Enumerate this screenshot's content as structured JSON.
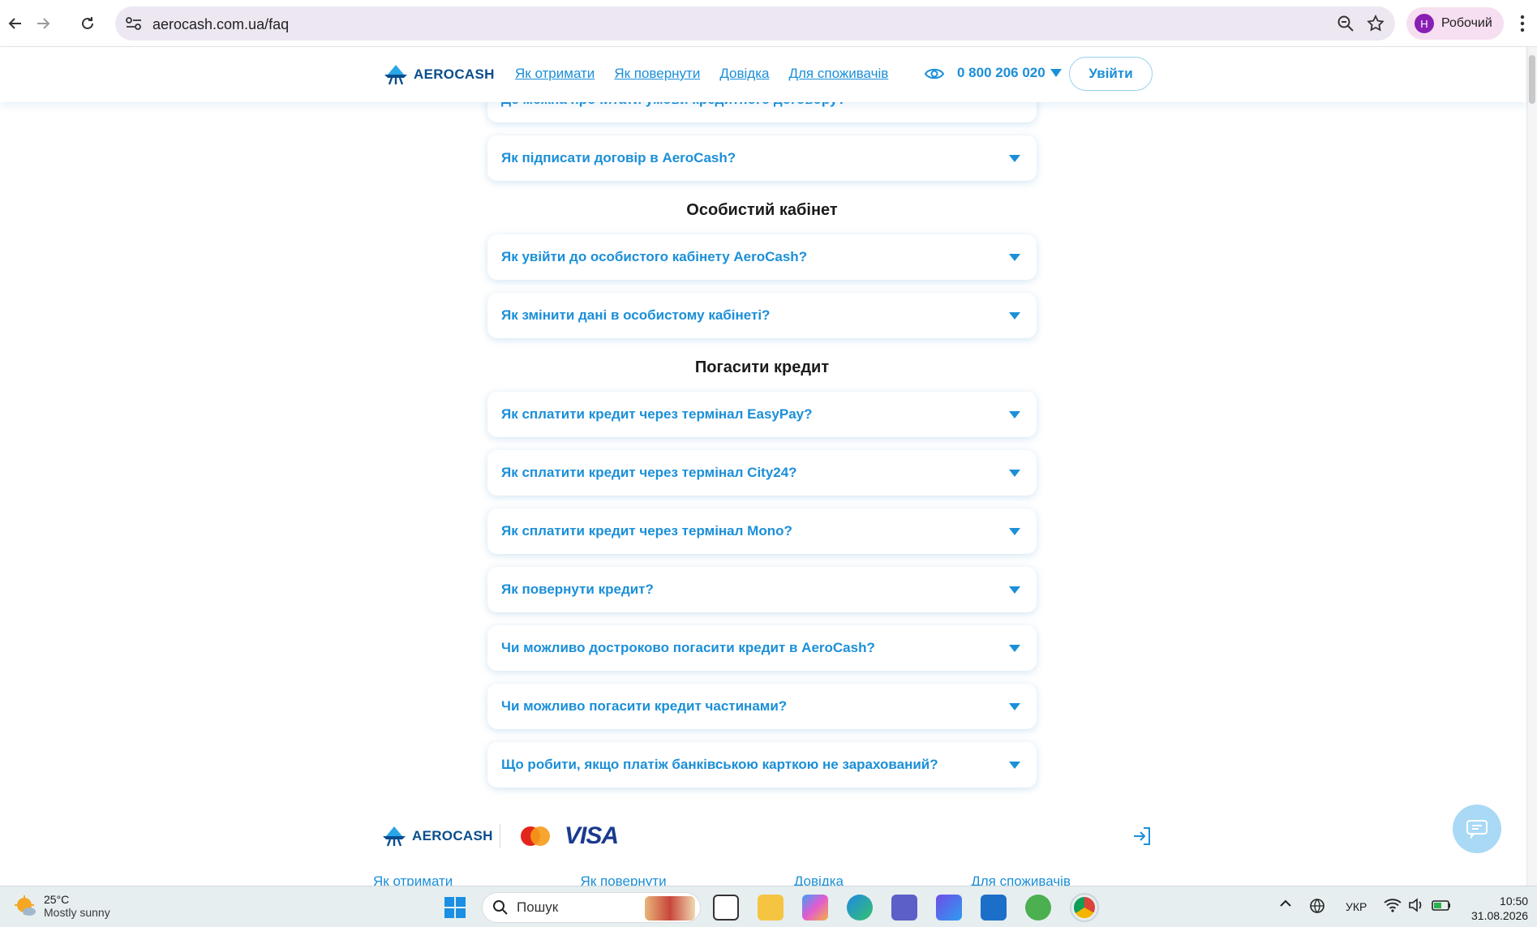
{
  "browser": {
    "url": "aerocash.com.ua/faq",
    "profile_initial": "Н",
    "profile_name": "Робочий"
  },
  "header": {
    "logo_text": "AEROCASH",
    "nav": [
      "Як отримати",
      "Як повернути",
      "Довідка",
      "Для споживачів"
    ],
    "phone": "0 800 206 020",
    "login_label": "Увійти"
  },
  "faq": {
    "partial_item": "Де можна прочитати умови кредитного договору?",
    "contract_items": [
      "Як підписати договір в AeroCash?"
    ],
    "section_cabinet": "Особистий кабінет",
    "cabinet_items": [
      "Як увійти до особистого кабінету AeroCash?",
      "Як змінити дані в особистому кабінеті?"
    ],
    "section_repay": "Погасити кредит",
    "repay_items": [
      "Як сплатити кредит через термінал EasyPay?",
      "Як сплатити кредит через термінал City24?",
      "Як сплатити кредит через термінал Mono?",
      "Як повернути кредит?",
      "Чи можливо достроково погасити кредит в AeroCash?",
      "Чи можливо погасити кредит частинами?",
      "Що робити, якщо платіж банківською карткою не зарахований?"
    ]
  },
  "footer": {
    "logo_text": "AEROCASH",
    "payment_visa": "VISA",
    "nav": [
      "Як отримати",
      "Як повернути",
      "Довідка",
      "Для споживачів"
    ]
  },
  "taskbar": {
    "weather_temp": "25°C",
    "weather_desc": "Mostly sunny",
    "search_placeholder": "Пошук",
    "language": "УКР",
    "time": "10:50",
    "date": "31.08.2026"
  },
  "colors": {
    "accent": "#1b8fd8",
    "logo": "#0a4d8c",
    "card_shadow": "#b8dcf2"
  }
}
